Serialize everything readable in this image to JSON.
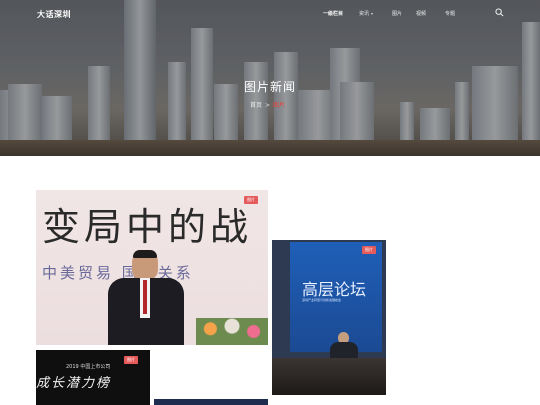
{
  "nav": {
    "brand": "大话深圳",
    "items": [
      {
        "label": "一级栏目",
        "active": true,
        "has_dropdown": false
      },
      {
        "label": "资讯",
        "active": false,
        "has_dropdown": true
      },
      {
        "label": "图片",
        "active": false,
        "has_dropdown": false
      },
      {
        "label": "视频",
        "active": false,
        "has_dropdown": false
      },
      {
        "label": "专题",
        "active": false,
        "has_dropdown": false
      }
    ],
    "search_icon": "search-icon"
  },
  "hero": {
    "title": "图片新闻",
    "breadcrumb": {
      "home": "首页",
      "separator": ">",
      "current": "图片"
    }
  },
  "photos": [
    {
      "badge": "图片",
      "banner_line1": "变局中的战",
      "banner_line2": "中美贸易  国际关系"
    },
    {
      "badge": "图片",
      "panel_title": "高层论坛",
      "panel_subtitle": "深圳产业转型与创新发展峰会"
    },
    {
      "badge": "图片",
      "banner_line1": "2019 中国上市公司",
      "banner_line2": "成长潜力榜"
    }
  ],
  "colors": {
    "accent": "#e8423a",
    "badge": "#e55b5b"
  }
}
